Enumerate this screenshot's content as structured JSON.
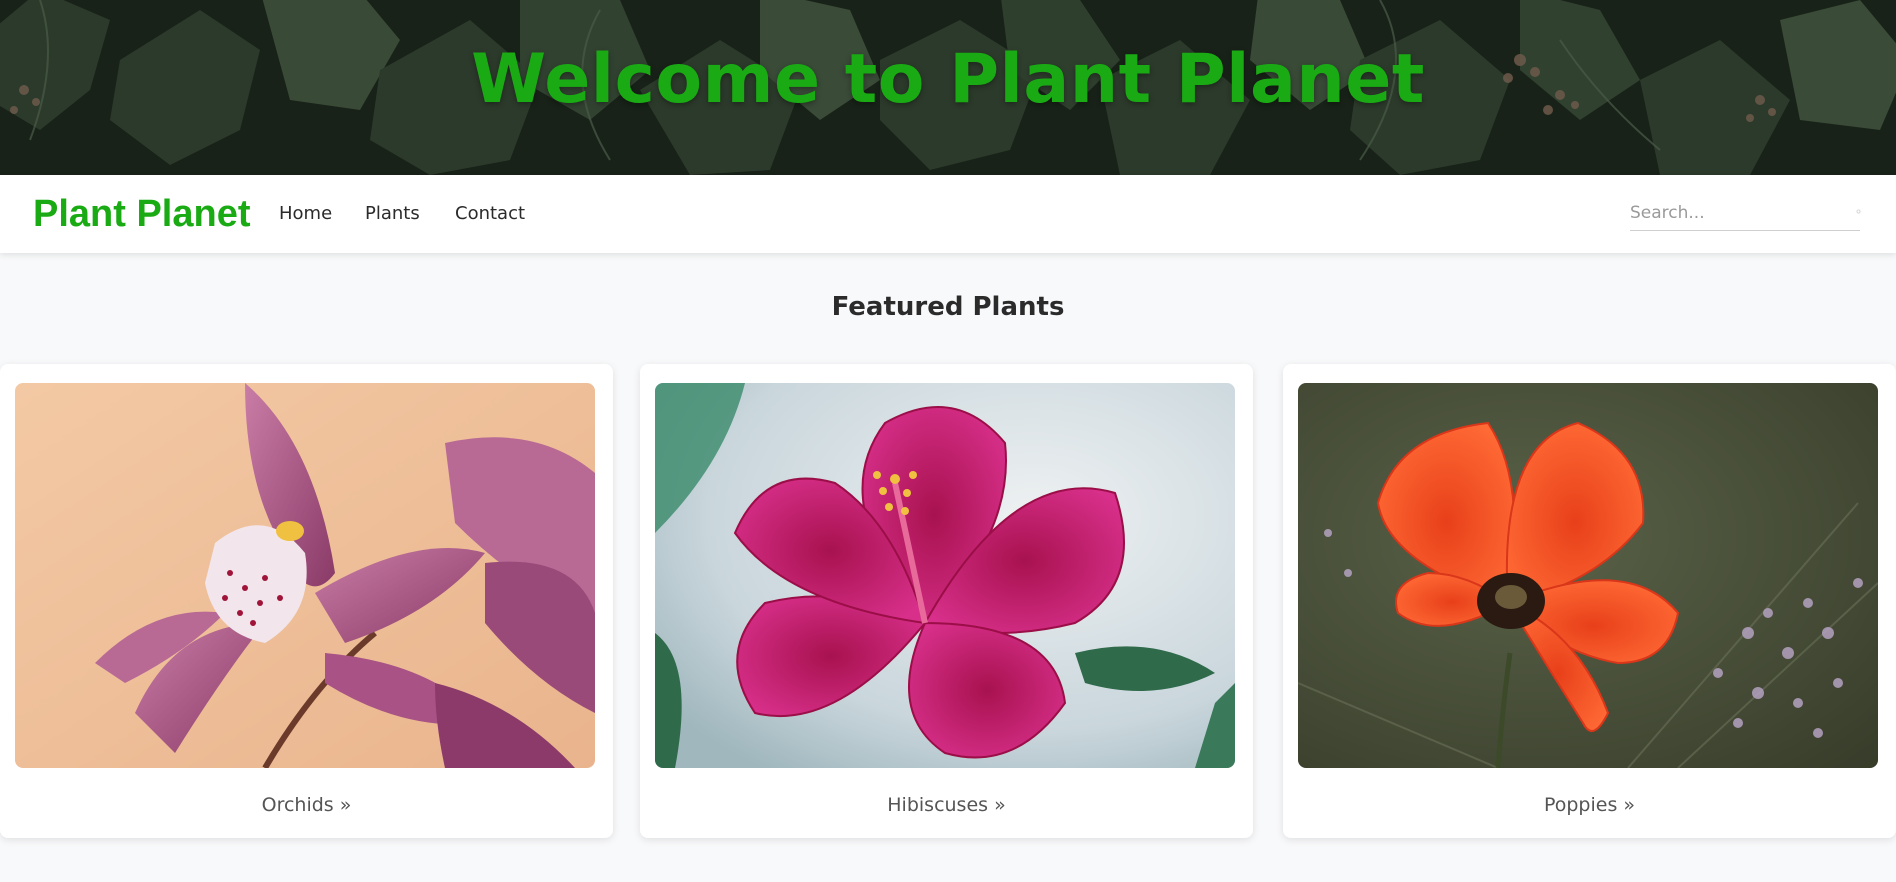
{
  "hero": {
    "title": "Welcome to Plant Planet",
    "background_icon": "ivy-leaves-photo"
  },
  "navbar": {
    "brand": "Plant Planet",
    "links": [
      {
        "label": "Home"
      },
      {
        "label": "Plants"
      },
      {
        "label": "Contact"
      }
    ],
    "search": {
      "placeholder": "Search...",
      "icon": "search-icon"
    }
  },
  "featured": {
    "title": "Featured Plants",
    "cards": [
      {
        "link_label": "Orchids »",
        "image": "orchid-photo"
      },
      {
        "link_label": "Hibiscuses »",
        "image": "hibiscus-photo"
      },
      {
        "link_label": "Poppies »",
        "image": "poppy-photo"
      }
    ]
  },
  "colors": {
    "brand_green": "#1aab14",
    "page_background": "#f8f9fa",
    "card_background": "#ffffff",
    "text_dark": "#2b2b2b",
    "text_muted": "#555555"
  }
}
